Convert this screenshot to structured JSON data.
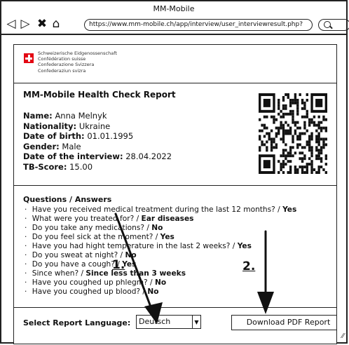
{
  "window": {
    "title": "MM-Mobile"
  },
  "nav": {
    "back": "◁",
    "forward": "▷",
    "close": "✖",
    "home": "⌂"
  },
  "url": "https://www.mm-mobile.ch/app/interview/user_interviewresult.php?",
  "header": {
    "gov_lines": [
      "Schweizerische Eidgenossenschaft",
      "Confédération suisse",
      "Confederazione Svizzera",
      "Confederaziun svizra"
    ]
  },
  "report": {
    "title": "MM-Mobile Health Check Report",
    "fields": [
      {
        "label": "Name:",
        "value": "Anna Melnyk"
      },
      {
        "label": "Nationality:",
        "value": "Ukraine"
      },
      {
        "label": "Date of birth:",
        "value": "01.01.1995"
      },
      {
        "label": "Gender:",
        "value": "Male"
      },
      {
        "label": "Date of the interview:",
        "value": "28.04.2022"
      },
      {
        "label": "TB-Score:",
        "value": "15.00"
      }
    ]
  },
  "qa": {
    "heading": "Questions / Answers",
    "items": [
      {
        "q": "Have you received medical treatment during the last 12 months? /",
        "a": "Yes"
      },
      {
        "q": "What were you treated for? /",
        "a": "Ear diseases"
      },
      {
        "q": "Do you take any medications? /",
        "a": "No"
      },
      {
        "q": "Do you feel sick at the moment? /",
        "a": "Yes"
      },
      {
        "q": "Have you had hight temperature in the last 2 weeks? /",
        "a": "Yes"
      },
      {
        "q": "Do you sweat at night? /",
        "a": "No"
      },
      {
        "q": "Do you have a cough? /",
        "a": "Yes"
      },
      {
        "q": "Since when? /",
        "a": "Since less than 3 weeks"
      },
      {
        "q": "Have you coughed up phlegm? /",
        "a": "No"
      },
      {
        "q": "Have you coughed up blood? /",
        "a": "No"
      }
    ]
  },
  "footer": {
    "language_label": "Select Report Language:",
    "language_value": "Deutsch",
    "download_label": "Download PDF Report"
  },
  "annotations": {
    "step1": "1.",
    "step2": "2."
  }
}
